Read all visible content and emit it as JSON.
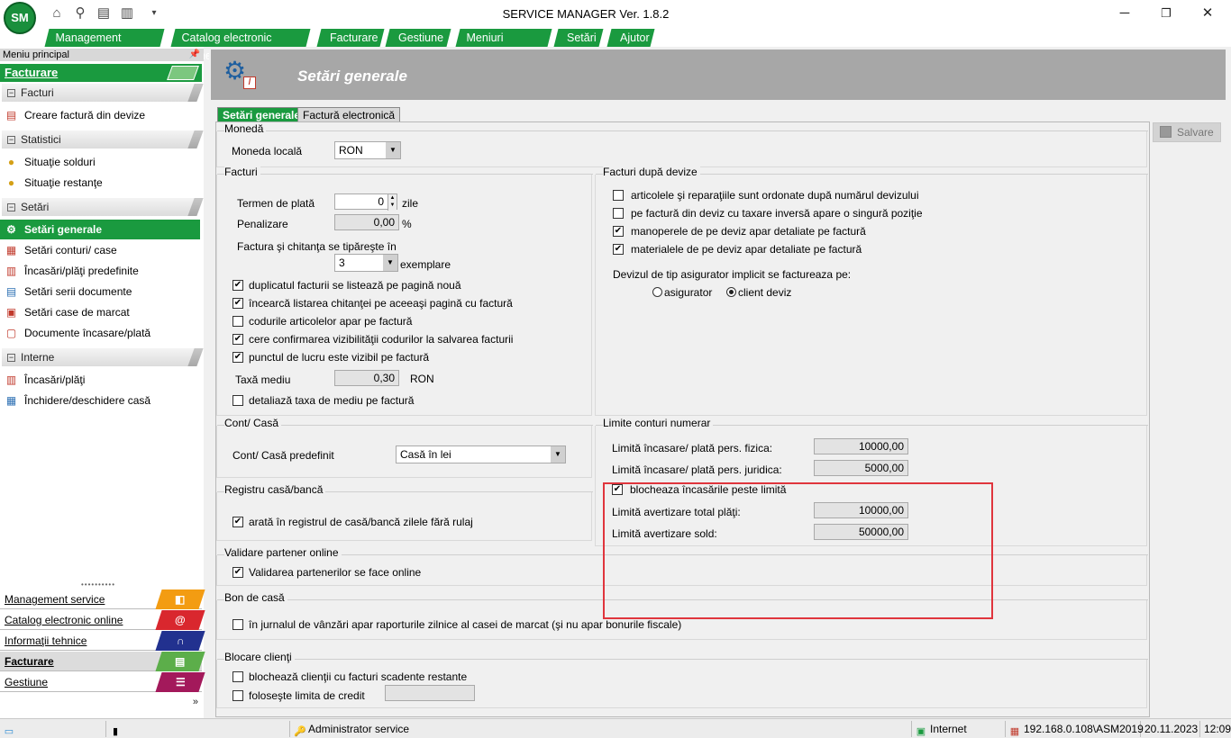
{
  "window": {
    "title": "SERVICE MANAGER Ver. 1.8.2",
    "logo": "SM"
  },
  "menubar": [
    "Management service",
    "Catalog electronic online",
    "Facturare",
    "Gestiune",
    "Meniuri favorite",
    "Setări",
    "Ajutor"
  ],
  "sidebar": {
    "header": "Meniu principal",
    "section_title": "Facturare",
    "groups": [
      {
        "label": "Facturi",
        "items": [
          "Creare factură din devize"
        ]
      },
      {
        "label": "Statistici",
        "items": [
          "Situaţie solduri",
          "Situaţie restanţe"
        ]
      },
      {
        "label": "Setări",
        "items": [
          "Setări generale",
          "Setări conturi/ case",
          "Încasări/plăţi predefinite",
          "Setări serii documente",
          "Setări case de marcat",
          "Documente încasare/plată"
        ]
      },
      {
        "label": "Interne",
        "items": [
          "Încasări/plăţi",
          "Închidere/deschidere casă"
        ]
      }
    ],
    "modules": [
      "Management service",
      "Catalog electronic online",
      "Informaţii tehnice",
      "Facturare",
      "Gestiune"
    ]
  },
  "main": {
    "title": "Setări generale",
    "tabs": [
      "Setări generale",
      "Factură electronică"
    ],
    "save_label": "Salvare",
    "moneda": {
      "legend": "Monedă",
      "label": "Moneda locală",
      "value": "RON"
    },
    "facturi": {
      "legend": "Facturi",
      "termen_label": "Termen de plată",
      "termen_value": "0",
      "termen_unit": "zile",
      "penalizare_label": "Penalizare",
      "penalizare_value": "0,00",
      "penalizare_unit": "%",
      "exemplare_label": "Factura şi chitanţa se tipăreşte în",
      "exemplare_value": "3",
      "exemplare_unit": "exemplare",
      "checks": [
        {
          "label": "duplicatul facturii se listează pe pagină nouă",
          "checked": true
        },
        {
          "label": "încearcă listarea chitanţei pe aceeaşi pagină cu factură",
          "checked": true
        },
        {
          "label": "codurile articolelor apar pe factură",
          "checked": false
        },
        {
          "label": "cere confirmarea vizibilităţii codurilor la salvarea facturii",
          "checked": true
        },
        {
          "label": "punctul de lucru este vizibil pe factură",
          "checked": true
        }
      ],
      "taxa_label": "Taxă mediu",
      "taxa_value": "0,30",
      "taxa_unit": "RON",
      "detaliaza_label": "detaliază taxa de mediu pe factură",
      "detaliaza_checked": false
    },
    "facturi_devize": {
      "legend": "Facturi după devize",
      "checks": [
        {
          "label": "articolele şi reparaţiile sunt ordonate după numărul devizului",
          "checked": false
        },
        {
          "label": "pe factură din deviz cu taxare inversă apare o singură poziţie",
          "checked": false
        },
        {
          "label": "manoperele de pe deviz apar detaliate pe factură",
          "checked": true
        },
        {
          "label": "materialele de pe deviz apar detaliate pe factură",
          "checked": true
        }
      ],
      "asigurator_label": "Devizul de tip asigurator implicit se factureaza pe:",
      "radio_asigurator": "asigurator",
      "radio_client": "client deviz"
    },
    "cont_casa": {
      "legend": "Cont/ Casă",
      "label": "Cont/ Casă predefinit",
      "value": "Casă în lei"
    },
    "limite": {
      "legend": "Limite conturi numerar",
      "fizica_label": "Limită încasare/ plată pers. fizica:",
      "fizica_value": "10000,00",
      "juridica_label": "Limită încasare/ plată pers. juridica:",
      "juridica_value": "5000,00",
      "blocheaza_label": "blocheaza încasările peste limită",
      "blocheaza_checked": true,
      "total_label": "Limită avertizare total plăţi:",
      "total_value": "10000,00",
      "sold_label": "Limită avertizare sold:",
      "sold_value": "50000,00"
    },
    "registru": {
      "legend": "Registru casă/bancă",
      "check_label": "arată în registrul de casă/bancă zilele fără rulaj",
      "checked": true
    },
    "validare": {
      "legend": "Validare partener online",
      "check_label": "Validarea partenerilor se face online",
      "checked": true
    },
    "bon": {
      "legend": "Bon de casă",
      "check_label": "în jurnalul de vânzări apar raporturile zilnice al casei de marcat (şi nu apar bonurile fiscale)",
      "checked": false
    },
    "blocare": {
      "legend": "Blocare clienţi",
      "check1": "blochează clienţii cu facturi scadente restante",
      "check2": "foloseşte limita de credit"
    }
  },
  "statusbar": {
    "user": "Administrator service",
    "connection": "Internet",
    "server": "192.168.0.108\\ASM2019",
    "date": "20.11.2023",
    "time": "12:09"
  },
  "colors": {
    "accent": "#1a9a3f",
    "highlight": "#e0353d",
    "header": "#a7a7a7"
  }
}
